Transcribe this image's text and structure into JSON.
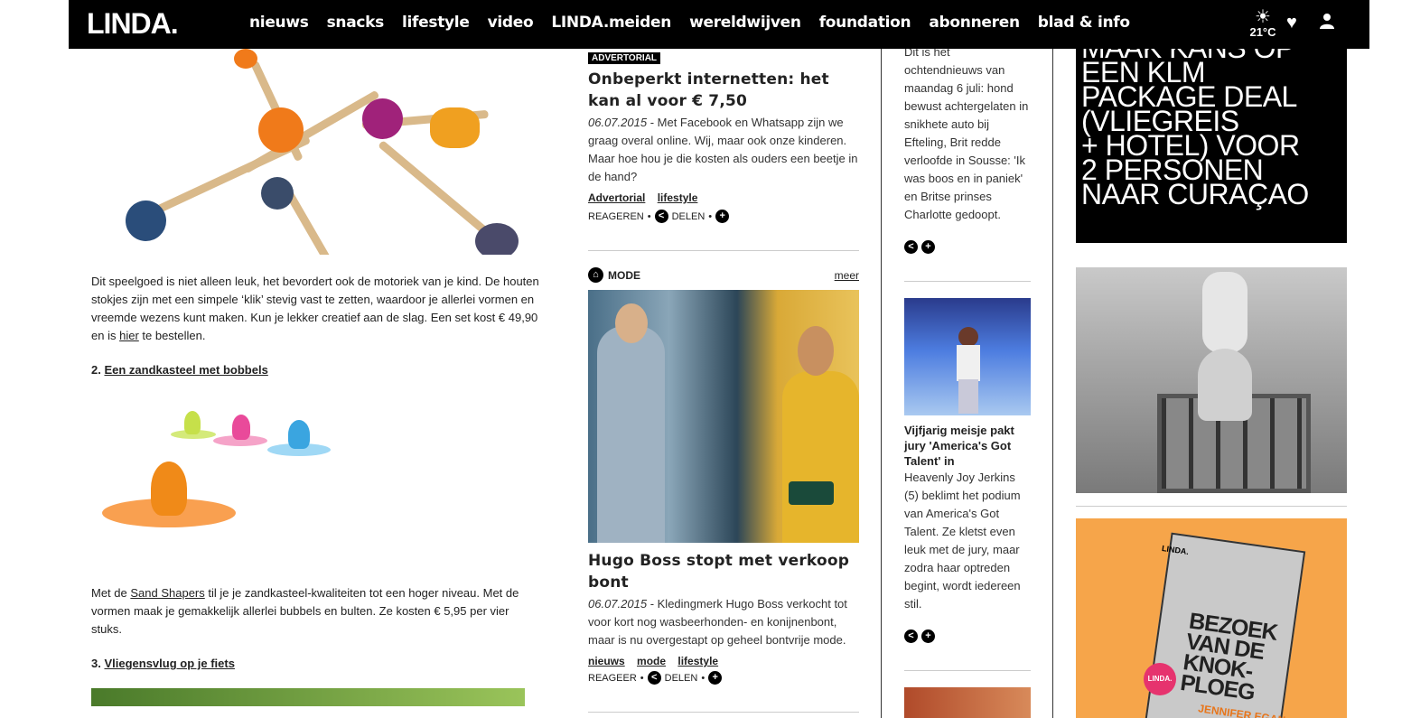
{
  "header": {
    "logo": "LINDA.",
    "nav": [
      "nieuws",
      "snacks",
      "lifestyle",
      "video",
      "LINDA.meiden",
      "wereldwijven",
      "foundation",
      "abonneren",
      "blad & info"
    ],
    "weather_temp": "21°C",
    "weather_icon": "sun-icon"
  },
  "left": {
    "para1": "Dit speelgoed is niet alleen leuk, het bevordert ook de motoriek van je kind. De houten stokjes zijn met een simpele ‘klik’ stevig vast te zetten, waardoor je allerlei vormen en vreemde wezens kunt maken. Kun je lekker creatief aan de slag. Een set kost € 49,90 en is",
    "para1_link": "hier",
    "para1_end": " te bestellen.",
    "item2_num": "2.",
    "item2_title": "Een zandkasteel met bobbels",
    "para2_start": "Met de ",
    "para2_link": "Sand Shapers",
    "para2_end": " til je je zandkasteel-kwaliteiten tot een hoger niveau. Met de vormen maak je gemakkelijk allerlei bubbels en bulten. Ze kosten € 5,95 per vier stuks.",
    "item3_num": "3.",
    "item3_title": "Vliegensvlug op je fiets"
  },
  "mid": {
    "adv_badge": "ADVERTORIAL",
    "article1": {
      "title": "Onbeperkt internetten: het kan al voor € 7,50",
      "date": "06.07.2015",
      "teaser": " - Met Facebook en Whatsapp zijn we graag overal online. Wij, maar ook onze kinderen. Maar hoe hou je die kosten als ouders een beetje in de hand?",
      "tags": [
        "Advertorial",
        "lifestyle"
      ],
      "react": "REAGEREN",
      "share": "DELEN"
    },
    "section_label": "MODE",
    "section_more": "meer",
    "article2": {
      "title": "Hugo Boss stopt met verkoop bont",
      "date": "06.07.2015",
      "teaser": " - Kledingmerk Hugo Boss verkocht tot voor kort nog wasbeerhonden- en konijnenbont, maar is nu overgestapt op geheel bontvrije mode.",
      "tags": [
        "nieuws",
        "mode",
        "lifestyle"
      ],
      "react": "REAGEER",
      "share": "DELEN"
    }
  },
  "third": {
    "news_teaser": "Dit is het ochtendnieuws van maandag 6 juli: hond bewust achtergelaten in snikhete auto bij Efteling, Brit redde verloofde in Sousse: 'Ik was boos en in paniek' en Britse prinses Charlotte gedoopt.",
    "talent_title": "Vijfjarig meisje pakt jury 'America's Got Talent' in",
    "talent_teaser": "Heavenly Joy Jerkins (5) beklimt het podium van America's Got Talent. Ze kletst even leuk met de jury, maar zodra haar optreden begint, wordt iedereen stil."
  },
  "right": {
    "klm_lines": [
      "MAAK KANS OP",
      "EEN KLM",
      "PACKAGE DEAL",
      "(VLIEGREIS",
      "+ HOTEL) VOOR",
      "2 PERSONEN",
      "NAAR CURAÇAO"
    ],
    "book_title": "BEZOEK VAN DE KNOK-PLOEG",
    "book_author": "JENNIFER EGAN",
    "book_brand": "LINDA.",
    "book_sticker": "LINDA."
  }
}
